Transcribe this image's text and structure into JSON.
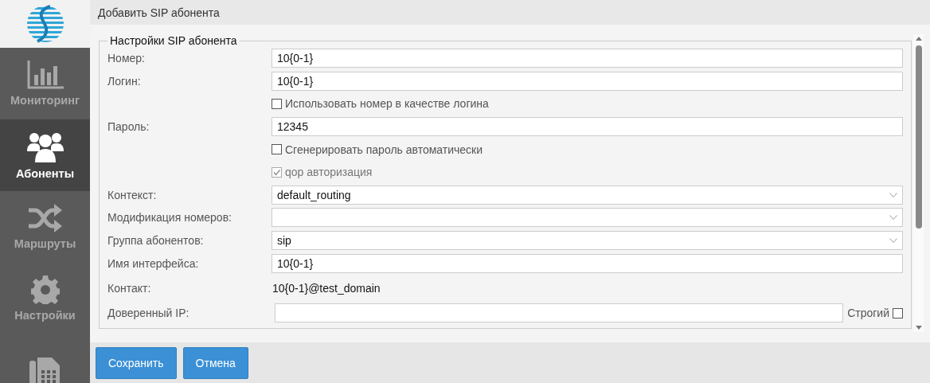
{
  "sidebar": {
    "items": [
      {
        "label": "Мониторинг",
        "selected": false
      },
      {
        "label": "Абоненты",
        "selected": true
      },
      {
        "label": "Маршруты",
        "selected": false
      },
      {
        "label": "Настройки",
        "selected": false
      },
      {
        "selected": false
      }
    ]
  },
  "dialog": {
    "title": "Добавить SIP абонента",
    "fieldset": {
      "legend": "Настройки SIP абонента",
      "rows": [
        {
          "kind": "text",
          "label": "Номер:",
          "value": "10{0-1}"
        },
        {
          "kind": "text",
          "label": "Логин:",
          "value": "10{0-1}"
        },
        {
          "kind": "checkbox",
          "label": "Использовать номер в качестве логина",
          "checked": false,
          "disabled": false
        },
        {
          "kind": "text",
          "label": "Пароль:",
          "value": "12345"
        },
        {
          "kind": "checkbox",
          "label": "Сгенерировать пароль автоматически",
          "checked": false,
          "disabled": false
        },
        {
          "kind": "checkbox",
          "label": "qop авторизация",
          "checked": true,
          "disabled": true
        },
        {
          "kind": "select",
          "label": "Контекст:",
          "value": "default_routing"
        },
        {
          "kind": "select",
          "label": "Модификация номеров:"
        },
        {
          "kind": "select",
          "label": "Группа абонентов:",
          "value": "sip"
        },
        {
          "kind": "text",
          "label": "Имя интерфейса:",
          "value": "10{0-1}"
        },
        {
          "kind": "static",
          "label": "Контакт:",
          "value": "10{0-1}@test_domain"
        },
        {
          "kind": "text_check",
          "label": "Доверенный IP:",
          "check_label": "Строгий",
          "checked": false
        }
      ]
    },
    "buttons": [
      "Сохранить",
      "Отмена"
    ]
  }
}
